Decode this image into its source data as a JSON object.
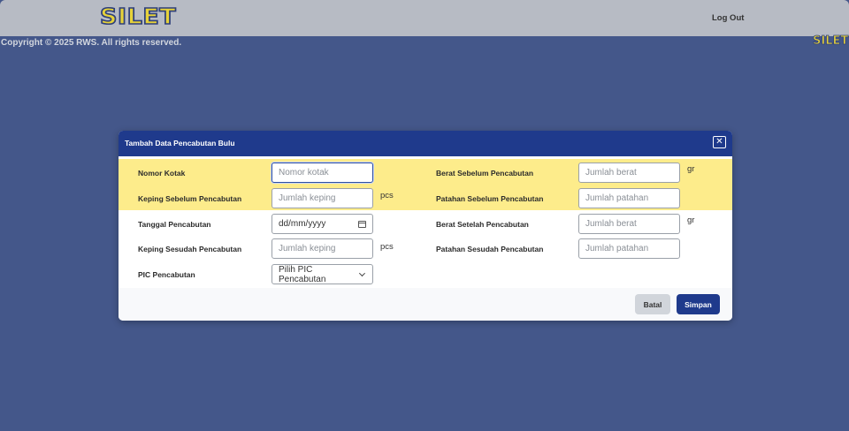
{
  "header": {
    "logo": "SILET",
    "logout_label": "Log Out"
  },
  "footer": {
    "copyright": "Copyright © 2025 RWS. All rights reserved.",
    "logo_small": "SILET"
  },
  "modal": {
    "title": "Tambah Data Pencabutan Bulu",
    "left_fields": {
      "nomor_kotak": {
        "label": "Nomor Kotak",
        "placeholder": "Nomor kotak"
      },
      "keping_sebelum": {
        "label": "Keping Sebelum Pencabutan",
        "placeholder": "Jumlah keping",
        "unit": "pcs"
      },
      "tanggal": {
        "label": "Tanggal Pencabutan",
        "placeholder": "dd/mm/yyyy"
      },
      "keping_sesudah": {
        "label": "Keping Sesudah Pencabutan",
        "placeholder": "Jumlah keping",
        "unit": "pcs"
      },
      "pic": {
        "label": "PIC Pencabutan",
        "selected": "Pilih PIC Pencabutan"
      }
    },
    "right_fields": {
      "berat_sebelum": {
        "label": "Berat Sebelum Pencabutan",
        "placeholder": "Jumlah berat",
        "unit": "gr"
      },
      "patahan_sebelum": {
        "label": "Patahan Sebelum Pencabutan",
        "placeholder": "Jumlah patahan"
      },
      "berat_setelah": {
        "label": "Berat Setelah Pencabutan",
        "placeholder": "Jumlah berat",
        "unit": "gr"
      },
      "patahan_sesudah": {
        "label": "Patahan Sesudah Pencabutan",
        "placeholder": "Jumlah patahan"
      }
    },
    "buttons": {
      "cancel": "Batal",
      "save": "Simpan"
    }
  },
  "colors": {
    "background": "#44578a",
    "topbar": "#b7bbc4",
    "modal_header": "#1f3a8c",
    "highlight_band": "#fdec8b",
    "logo_fill": "#e6d23a"
  }
}
